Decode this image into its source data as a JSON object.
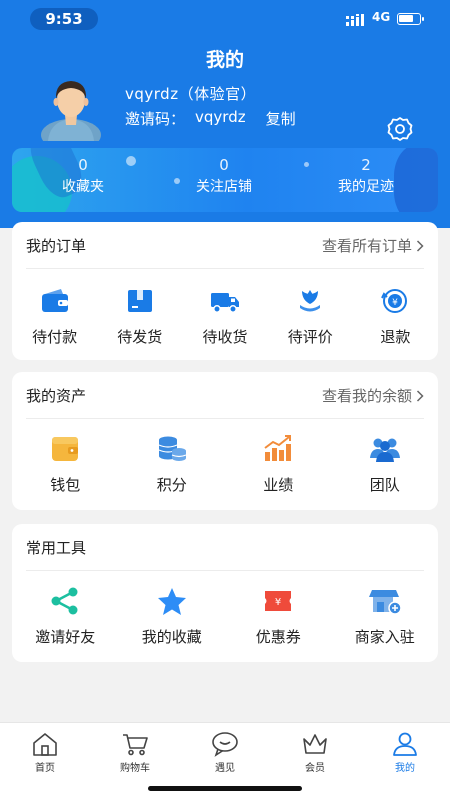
{
  "status": {
    "time": "9:53",
    "network": "4G"
  },
  "header": {
    "title": "我的"
  },
  "user": {
    "name": "vqyrdz（体验官）",
    "invite_label": "邀请码：",
    "invite_code": "vqyrdz",
    "copy_label": "复制"
  },
  "stats": [
    {
      "count": "0",
      "label": "收藏夹"
    },
    {
      "count": "0",
      "label": "关注店铺"
    },
    {
      "count": "2",
      "label": "我的足迹"
    }
  ],
  "orders": {
    "title": "我的订单",
    "more": "查看所有订单",
    "items": [
      {
        "label": "待付款",
        "icon": "wallet-icon"
      },
      {
        "label": "待发货",
        "icon": "package-icon"
      },
      {
        "label": "待收货",
        "icon": "truck-icon"
      },
      {
        "label": "待评价",
        "icon": "flower-icon"
      },
      {
        "label": "退款",
        "icon": "refund-icon"
      }
    ]
  },
  "assets": {
    "title": "我的资产",
    "more": "查看我的余额",
    "items": [
      {
        "label": "钱包",
        "icon": "wallet-icon"
      },
      {
        "label": "积分",
        "icon": "coins-icon"
      },
      {
        "label": "业绩",
        "icon": "chart-icon"
      },
      {
        "label": "团队",
        "icon": "team-icon"
      }
    ]
  },
  "tools": {
    "title": "常用工具",
    "items": [
      {
        "label": "邀请好友",
        "icon": "share-icon"
      },
      {
        "label": "我的收藏",
        "icon": "star-icon"
      },
      {
        "label": "优惠券",
        "icon": "coupon-icon"
      },
      {
        "label": "商家入驻",
        "icon": "store-icon"
      }
    ]
  },
  "tabbar": [
    {
      "label": "首页",
      "icon": "home-icon"
    },
    {
      "label": "购物车",
      "icon": "cart-icon"
    },
    {
      "label": "遇见",
      "icon": "chat-icon"
    },
    {
      "label": "会员",
      "icon": "crown-icon"
    },
    {
      "label": "我的",
      "icon": "user-icon",
      "active": true
    }
  ],
  "colors": {
    "primary": "#1a7be6",
    "accent_orange": "#f5a623",
    "accent_red": "#ef4b3b",
    "accent_teal": "#1cbfa0"
  }
}
